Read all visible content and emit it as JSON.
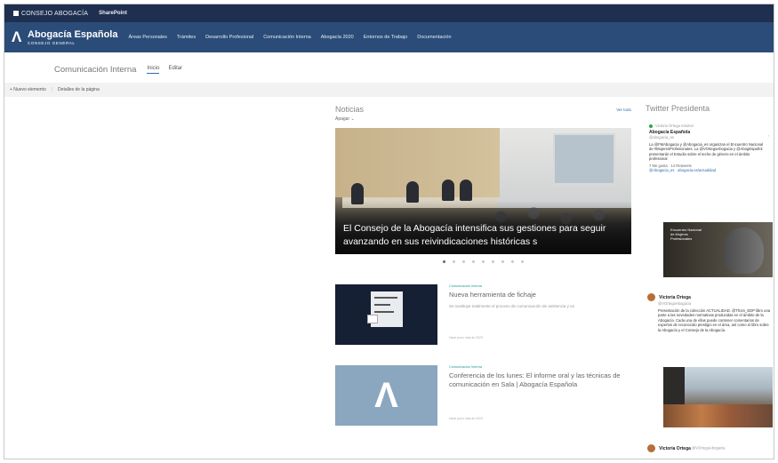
{
  "suitebar": {
    "brand": "CONSEJO ABOGACÍA",
    "app": "SharePoint"
  },
  "header": {
    "logo_title": "Abogacía Española",
    "logo_sub": "CONSEJO GENERAL",
    "nav": [
      "Áreas Personales",
      "Trámites",
      "Desarrollo Profesional",
      "Comunicación Interna",
      "Abogacía 2020",
      "Entornos de Trabajo",
      "Documentación"
    ]
  },
  "subheader": {
    "site_title": "Comunicación Interna",
    "tabs": [
      "Inicio",
      "Editar"
    ]
  },
  "commandbar": {
    "items": [
      "+ Nuevo elemento",
      "Detalles de la página"
    ]
  },
  "news": {
    "title": "Noticias",
    "see_all": "Ver todo",
    "filter": "Apagar",
    "hero_caption": "El Consejo de la Abogacía intensifica sus gestiones para seguir avanzando en sus reivindicaciones históricas s",
    "dots": 9,
    "active_dot": 0,
    "items": [
      {
        "category": "Comunicación Interna",
        "title": "Nueva herramienta de fichaje",
        "summary": "Se sustituye totalmente el proceso de comunicación de asistencia y va",
        "date": "Hace poco más de 2023"
      },
      {
        "category": "Comunicación Interna",
        "title": "Conferencia de los lunes: El informe oral y las técnicas de comunicación en Sala | Abogacía Española",
        "summary": "",
        "date": "Hace poco más de 2023"
      }
    ]
  },
  "twitter": {
    "title": "Twitter Presidenta",
    "tweet1": {
      "meta": "Victoria Ortega retuiteó",
      "user": "Abogacía Española",
      "handle": "@abogacia_es",
      "text": "La @FMAbogacia y @Abogacia_es organizan el Encuentro Nacional de #MujeresProfesionales. La @VOrtegaAbogacia y @AbogEspañol presentarán el Estudio sobre el techo de género en el ámbito profesional",
      "stats": "7 Me gusta · 14 Retweets",
      "link": "@Abogacia_es · abogacia.es/actualidad"
    },
    "image1_badge": "Encuentro Nacional de Mujeres Profesionales",
    "tweet2": {
      "user": "Victoria Ortega",
      "handle": "@VOrtegaAbogacia",
      "text": "Presentación de la colección ACTUALIDAD. @Thom_EDP libro una parte a las novedades normativas producidas en el ámbito de la Abogacía. Cada una de ellas puede contener comentarios de expertos de reconocido prestigio en el área, así como el libro sobre la Abogacía y el Consejo de la Abogacía."
    },
    "tweet3": {
      "user": "Victoria Ortega",
      "handle": "@VOrtegaAbogacia"
    }
  }
}
